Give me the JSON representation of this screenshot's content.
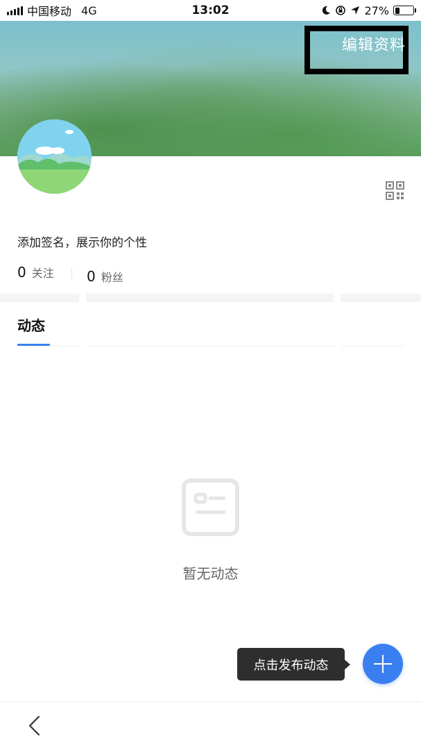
{
  "status_bar": {
    "carrier": "中国移动",
    "network": "4G",
    "time": "13:02",
    "battery_percent": "27%",
    "battery_level": 0.27,
    "icons": [
      "signal-icon",
      "moon-icon",
      "orientation-lock-icon",
      "location-icon",
      "battery-icon"
    ]
  },
  "header": {
    "edit_profile_label": "编辑资料",
    "icons": [
      "avatar",
      "qr-code-icon"
    ]
  },
  "profile": {
    "signature": "添加签名，展示你的个性",
    "following_count": "0",
    "following_label": "关注",
    "fans_count": "0",
    "fans_label": "粉丝"
  },
  "tabs": {
    "moments_label": "动态"
  },
  "empty_state": {
    "icon": "empty-feed-icon",
    "message": "暂无动态"
  },
  "actions": {
    "publish_tooltip": "点击发布动态",
    "fab_icon": "plus-icon",
    "accent_color": "#3a7ff0"
  },
  "bottom_bar": {
    "icon": "back-icon"
  }
}
